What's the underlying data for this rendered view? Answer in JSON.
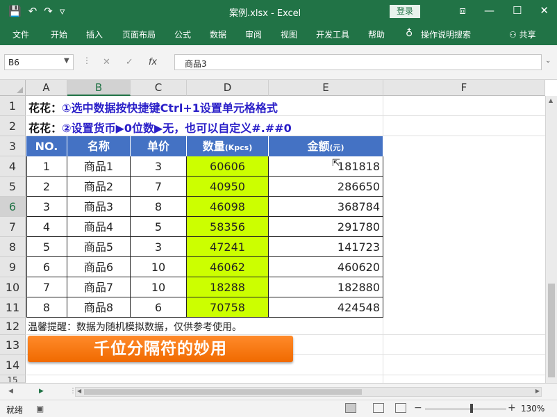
{
  "titlebar": {
    "title": "案例.xlsx  -  Excel",
    "login": "登录",
    "qat": {
      "save_icon": "💾",
      "undo_icon": "↶",
      "redo_icon": "↷",
      "customize_icon": "▿"
    },
    "controls": {
      "ribbon_display": "⧈",
      "minimize": "—",
      "maximize": "☐",
      "close": "✕"
    }
  },
  "ribbon": {
    "tabs": [
      "文件",
      "开始",
      "插入",
      "页面布局",
      "公式",
      "数据",
      "审阅",
      "视图",
      "开发工具",
      "帮助"
    ],
    "tell_me": "操作说明搜索",
    "share": "共享"
  },
  "formula_bar": {
    "name_box": "B6",
    "cancel": "✕",
    "enter": "✓",
    "fx": "fx",
    "content": "商品3"
  },
  "grid": {
    "columns": [
      "A",
      "B",
      "C",
      "D",
      "E",
      "F"
    ],
    "rows": [
      "1",
      "2",
      "3",
      "4",
      "5",
      "6",
      "7",
      "8",
      "9",
      "10",
      "11",
      "12",
      "13",
      "14",
      "15"
    ],
    "note1_prefix": "花花：",
    "note1": "①选中数据按快捷键Ctrl+1设置单元格格式",
    "note2_prefix": "花花：",
    "note2": "②设置货币▶0位数▶无，也可以自定义#.##0",
    "table": {
      "headers": [
        "NO.",
        "名称",
        "单价",
        "数量",
        "金额"
      ],
      "header_suffix_qty": "(Kpcs)",
      "header_suffix_amt": "(元)",
      "rows": [
        {
          "no": "1",
          "name": "商品1",
          "price": "3",
          "qty": "60606",
          "amount": "181818"
        },
        {
          "no": "2",
          "name": "商品2",
          "price": "7",
          "qty": "40950",
          "amount": "286650"
        },
        {
          "no": "3",
          "name": "商品3",
          "price": "8",
          "qty": "46098",
          "amount": "368784"
        },
        {
          "no": "4",
          "name": "商品4",
          "price": "5",
          "qty": "58356",
          "amount": "291780"
        },
        {
          "no": "5",
          "name": "商品5",
          "price": "3",
          "qty": "47241",
          "amount": "141723"
        },
        {
          "no": "6",
          "name": "商品6",
          "price": "10",
          "qty": "46062",
          "amount": "460620"
        },
        {
          "no": "7",
          "name": "商品7",
          "price": "10",
          "qty": "18288",
          "amount": "182880"
        },
        {
          "no": "8",
          "name": "商品8",
          "price": "6",
          "qty": "70758",
          "amount": "424548"
        }
      ]
    },
    "footnote": "温馨提醒：数据为随机模拟数据，仅供参考使用。",
    "banner": "千位分隔符的妙用"
  },
  "status": {
    "ready": "就绪",
    "zoom": "130%",
    "zoom_minus": "−",
    "zoom_plus": "+"
  },
  "colors": {
    "excel_green": "#217346",
    "header_blue": "#4472c4",
    "qty_fill": "#ccff00",
    "note_blue": "#2a1fc8",
    "banner_orange": "#f57c00"
  }
}
